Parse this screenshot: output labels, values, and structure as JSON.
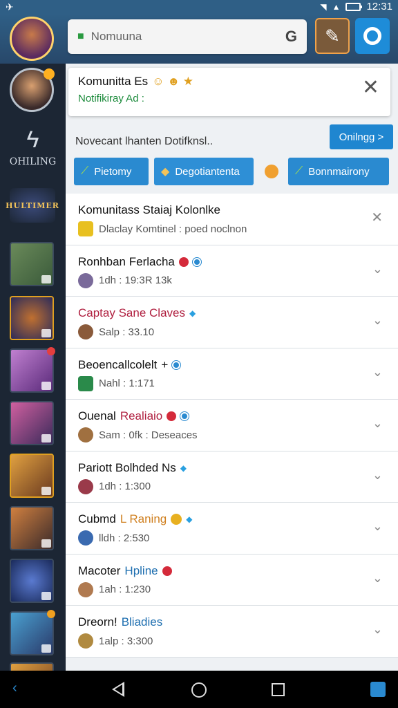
{
  "status": {
    "time": "12:31"
  },
  "search": {
    "placeholder": "Nomuuna"
  },
  "sidebar": {
    "logo_text": "OHILING",
    "game_logo": "HULTIMER"
  },
  "notice": {
    "title": "Komunitta Es",
    "subtitle": "Notifikiray Ad :"
  },
  "toolbar": {
    "description": "Novecant lhanten Dotifknsl..",
    "primary_label": "Onilngg >"
  },
  "chips": [
    {
      "label": "Pietomy"
    },
    {
      "label": "Degotiantenta"
    },
    {
      "label": "Bonnmairony"
    }
  ],
  "list": [
    {
      "title": "Komunitass Staiaj Kolonlke",
      "meta": "Dlaclay Komtinel : poed noclnon"
    },
    {
      "title": "Ronhban Ferlacha",
      "meta": "1dh : 19:3R 13k"
    },
    {
      "title": "Captay Sane Claves",
      "meta": "Salp : 33.10"
    },
    {
      "title": "Beoencallcolelt",
      "meta": "Nahl : 1:171"
    },
    {
      "title": "Ouenal",
      "title_accent": "Realiaio",
      "meta": "Sam : 0fk : Deseaces"
    },
    {
      "title": "Pariott Bolhded Ns",
      "meta": "1dh : 1:300"
    },
    {
      "title": "Cubmd",
      "title_accent": "L Raning",
      "meta": "lldh : 2:530"
    },
    {
      "title": "Macoter",
      "title_accent": "Hpline",
      "meta": "1ah : 1:230"
    },
    {
      "title": "Dreorn!",
      "title_accent": "Bliadies",
      "meta": "1alp : 3:300"
    }
  ],
  "colors": {
    "accent_blue": "#1f86d0",
    "sidebar_bg": "#1c2634",
    "green_sub": "#1a8a3a",
    "red_title": "#b02040"
  }
}
